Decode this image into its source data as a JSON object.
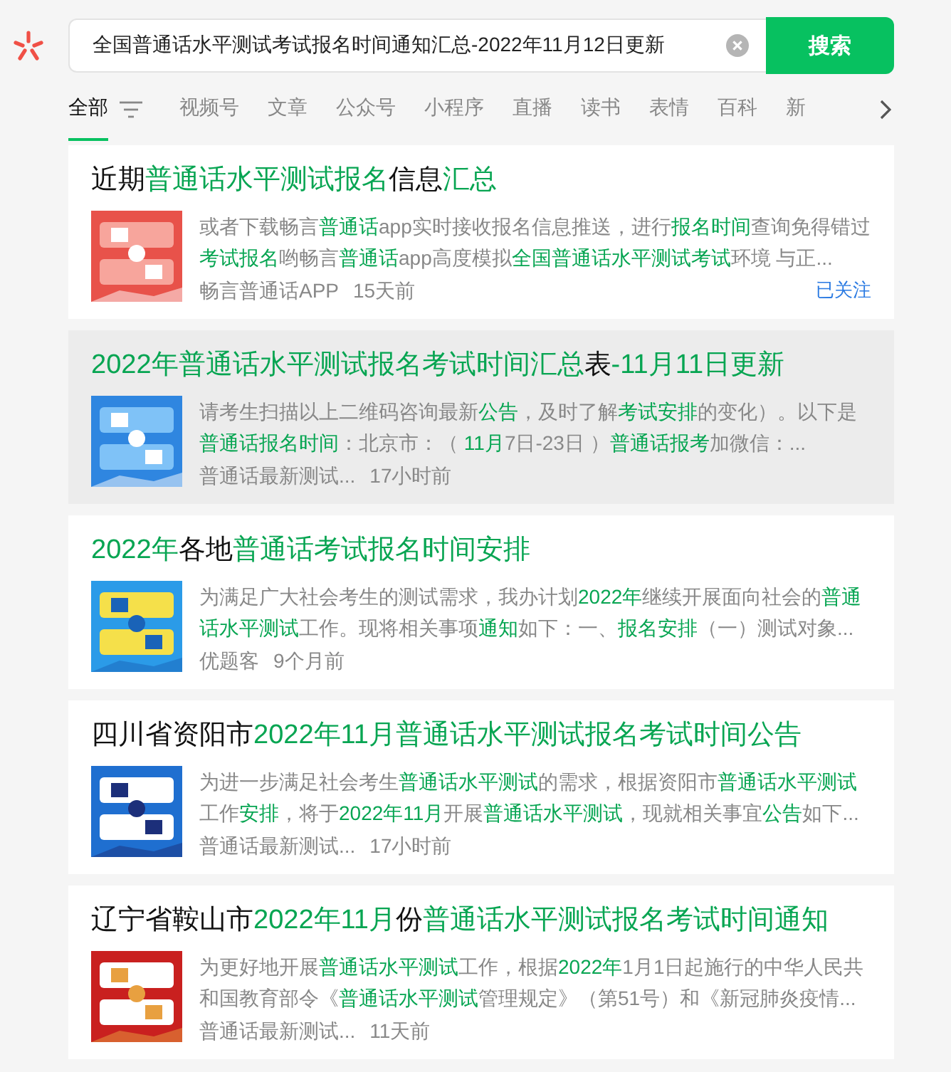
{
  "search": {
    "value": "全国普通话水平测试考试报名时间通知汇总-2022年11月12日更新",
    "button": "搜索"
  },
  "tabs": [
    {
      "label": "全部",
      "selected": true
    },
    {
      "label": "视频号",
      "selected": false
    },
    {
      "label": "文章",
      "selected": false
    },
    {
      "label": "公众号",
      "selected": false
    },
    {
      "label": "小程序",
      "selected": false
    },
    {
      "label": "直播",
      "selected": false
    },
    {
      "label": "读书",
      "selected": false
    },
    {
      "label": "表情",
      "selected": false
    },
    {
      "label": "百科",
      "selected": false
    },
    {
      "label": "新",
      "selected": false
    }
  ],
  "results": [
    {
      "selected": false,
      "title": [
        {
          "text": "近期",
          "hl": false
        },
        {
          "text": "普通话水平测试报名",
          "hl": true
        },
        {
          "text": "信息",
          "hl": false
        },
        {
          "text": "汇总",
          "hl": true
        }
      ],
      "snippet": [
        {
          "text": "或者下载畅言",
          "hl": false
        },
        {
          "text": "普通话",
          "hl": true
        },
        {
          "text": "app实时接收报名信息推送，进行",
          "hl": false
        },
        {
          "text": "报名时间",
          "hl": true
        },
        {
          "text": "查询免得错过",
          "hl": false
        },
        {
          "text": "考试报名",
          "hl": true
        },
        {
          "text": "哟畅言",
          "hl": false
        },
        {
          "text": "普通话",
          "hl": true
        },
        {
          "text": "app高度模拟",
          "hl": false
        },
        {
          "text": "全国普通话水平测试考试",
          "hl": true
        },
        {
          "text": "环境 与正...",
          "hl": false
        }
      ],
      "source": "畅言普通话APP",
      "time": "15天前",
      "follow": "已关注"
    },
    {
      "selected": true,
      "title": [
        {
          "text": "2022年普通话水平测试报名考试时间汇总",
          "hl": true
        },
        {
          "text": "表",
          "hl": false
        },
        {
          "text": "-11月11日更新",
          "hl": true
        }
      ],
      "snippet": [
        {
          "text": "请考生扫描以上二维码咨询最新",
          "hl": false
        },
        {
          "text": "公告",
          "hl": true
        },
        {
          "text": "，及时了解",
          "hl": false
        },
        {
          "text": "考试安排",
          "hl": true
        },
        {
          "text": "的变化）。以下是",
          "hl": false
        },
        {
          "text": "普通话报名时间",
          "hl": true
        },
        {
          "text": "：北京市：（ ",
          "hl": false
        },
        {
          "text": "11月",
          "hl": true
        },
        {
          "text": "7日-23日 ）",
          "hl": false
        },
        {
          "text": "普通话报考",
          "hl": true
        },
        {
          "text": "加微信：...",
          "hl": false
        }
      ],
      "source": "普通话最新测试...",
      "time": "17小时前"
    },
    {
      "selected": false,
      "title": [
        {
          "text": "2022年",
          "hl": true
        },
        {
          "text": "各地",
          "hl": false
        },
        {
          "text": "普通话考试报名时间安排",
          "hl": true
        }
      ],
      "snippet": [
        {
          "text": "为满足广大社会考生的测试需求，我办计划",
          "hl": false
        },
        {
          "text": "2022年",
          "hl": true
        },
        {
          "text": "继续开展面向社会的",
          "hl": false
        },
        {
          "text": "普通话水平测试",
          "hl": true
        },
        {
          "text": "工作。现将相关事项",
          "hl": false
        },
        {
          "text": "通知",
          "hl": true
        },
        {
          "text": "如下：一、",
          "hl": false
        },
        {
          "text": "报名安排",
          "hl": true
        },
        {
          "text": "（一）测试对象...",
          "hl": false
        }
      ],
      "source": "优题客",
      "time": "9个月前"
    },
    {
      "selected": false,
      "title": [
        {
          "text": "四川省资阳市",
          "hl": false
        },
        {
          "text": "2022年11月普通话水平测试报名考试时间公告",
          "hl": true
        }
      ],
      "snippet": [
        {
          "text": "为进一步满足社会考生",
          "hl": false
        },
        {
          "text": "普通话水平测试",
          "hl": true
        },
        {
          "text": "的需求，根据资阳市",
          "hl": false
        },
        {
          "text": "普通话水平测试",
          "hl": true
        },
        {
          "text": "工作",
          "hl": false
        },
        {
          "text": "安排",
          "hl": true
        },
        {
          "text": "，将于",
          "hl": false
        },
        {
          "text": "2022年11月",
          "hl": true
        },
        {
          "text": "开展",
          "hl": false
        },
        {
          "text": "普通话水平测试",
          "hl": true
        },
        {
          "text": "，现就相关事宜",
          "hl": false
        },
        {
          "text": "公告",
          "hl": true
        },
        {
          "text": "如下...",
          "hl": false
        }
      ],
      "source": "普通话最新测试...",
      "time": "17小时前"
    },
    {
      "selected": false,
      "title": [
        {
          "text": "辽宁省鞍山市",
          "hl": false
        },
        {
          "text": "2022年11月",
          "hl": true
        },
        {
          "text": "份",
          "hl": false
        },
        {
          "text": "普通话水平测试报名考试时间通知",
          "hl": true
        }
      ],
      "snippet": [
        {
          "text": "为更好地开展",
          "hl": false
        },
        {
          "text": "普通话水平测试",
          "hl": true
        },
        {
          "text": "工作，根据",
          "hl": false
        },
        {
          "text": "2022年",
          "hl": true
        },
        {
          "text": "1月1日起施行的中华人民共和国教育部令《",
          "hl": false
        },
        {
          "text": "普通话水平测试",
          "hl": true
        },
        {
          "text": "管理规定》（第51号）和《新冠肺炎疫情...",
          "hl": false
        }
      ],
      "source": "普通话最新测试...",
      "time": "11天前"
    }
  ]
}
